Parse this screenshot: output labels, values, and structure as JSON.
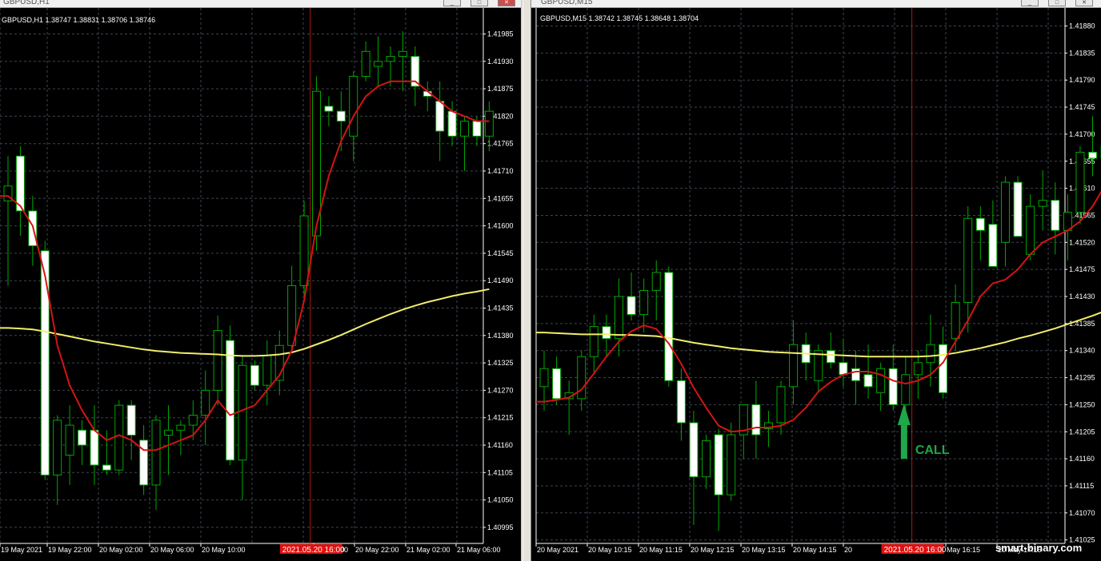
{
  "windows": [
    {
      "title": "GBPUSD,H1",
      "info": "GBPUSD,H1  1.38747 1.38831 1.38706 1.38746",
      "price_labels": [
        "1.41985",
        "1.41930",
        "1.41875",
        "1.41820",
        "1.41765",
        "1.41710",
        "1.41655",
        "1.41600",
        "1.41545",
        "1.41490",
        "1.41435",
        "1.41380",
        "1.41325",
        "1.41270",
        "1.41215",
        "1.41160",
        "1.41105",
        "1.41050",
        "1.40995"
      ],
      "time_labels": [
        "19 May 2021",
        "19 May 22:00",
        "20 May 02:00",
        "20 May 06:00",
        "20 May 10:00",
        "2021.05.20 16:00",
        "May 18:00",
        "20 May 22:00",
        "21 May 02:00",
        "21 May 06:00"
      ],
      "marker_label": "2021.05.20 16:00"
    },
    {
      "title": "GBPUSD,M15",
      "info": "GBPUSD,M15  1.38742 1.38745 1.38648 1.38704",
      "price_labels": [
        "1.41880",
        "1.41835",
        "1.41790",
        "1.41745",
        "1.41700",
        "1.41655",
        "1.41610",
        "1.41565",
        "1.41520",
        "1.41475",
        "1.41430",
        "1.41385",
        "1.41340",
        "1.41295",
        "1.41250",
        "1.41205",
        "1.41160",
        "1.41115",
        "1.41070",
        "1.41025"
      ],
      "time_labels": [
        "20 May 2021",
        "20 May 10:15",
        "20 May 11:15",
        "20 May 12:15",
        "20 May 13:15",
        "20 May 14:15",
        "20",
        "2021.05.20 16:00",
        "May 16:15",
        "20 May 17:15"
      ],
      "marker_label": "2021.05.20 16:00",
      "signal_label": "CALL",
      "watermark": "smart-binary.com"
    }
  ],
  "colors": {
    "background": "#000000",
    "grid": "#3c4452",
    "bull_candle": "#00a800",
    "bear_body": "#ffffff",
    "ma_fast": "#d41414",
    "ma_slow": "#f2ee6a",
    "marker": "#b01818",
    "marker_label_bg": "#e01010",
    "signal_arrow": "#1ea84a"
  },
  "chart_data": [
    {
      "type": "candlestick",
      "symbol": "GBPUSD",
      "timeframe": "H1",
      "ylim": [
        1.40975,
        1.42005
      ],
      "candles": [
        {
          "o": 1.4165,
          "h": 1.4174,
          "l": 1.4148,
          "c": 1.4168
        },
        {
          "o": 1.4174,
          "h": 1.4176,
          "l": 1.4158,
          "c": 1.4163
        },
        {
          "o": 1.4163,
          "h": 1.4166,
          "l": 1.4152,
          "c": 1.4156
        },
        {
          "o": 1.4155,
          "h": 1.4157,
          "l": 1.4109,
          "c": 1.411
        },
        {
          "o": 1.411,
          "h": 1.4122,
          "l": 1.4104,
          "c": 1.4121
        },
        {
          "o": 1.4114,
          "h": 1.4124,
          "l": 1.4108,
          "c": 1.412
        },
        {
          "o": 1.4119,
          "h": 1.4121,
          "l": 1.4112,
          "c": 1.4116
        },
        {
          "o": 1.4119,
          "h": 1.4124,
          "l": 1.4108,
          "c": 1.4112
        },
        {
          "o": 1.4112,
          "h": 1.4119,
          "l": 1.411,
          "c": 1.4111
        },
        {
          "o": 1.4111,
          "h": 1.4125,
          "l": 1.411,
          "c": 1.4124
        },
        {
          "o": 1.4124,
          "h": 1.4125,
          "l": 1.4113,
          "c": 1.4118
        },
        {
          "o": 1.4117,
          "h": 1.412,
          "l": 1.4106,
          "c": 1.4108
        },
        {
          "o": 1.4108,
          "h": 1.4122,
          "l": 1.4103,
          "c": 1.4121
        },
        {
          "o": 1.4118,
          "h": 1.4124,
          "l": 1.411,
          "c": 1.4119
        },
        {
          "o": 1.4119,
          "h": 1.4121,
          "l": 1.4114,
          "c": 1.412
        },
        {
          "o": 1.412,
          "h": 1.4125,
          "l": 1.4117,
          "c": 1.4122
        },
        {
          "o": 1.4122,
          "h": 1.4131,
          "l": 1.4116,
          "c": 1.4127
        },
        {
          "o": 1.4127,
          "h": 1.4142,
          "l": 1.4124,
          "c": 1.4139
        },
        {
          "o": 1.4137,
          "h": 1.414,
          "l": 1.4112,
          "c": 1.4113
        },
        {
          "o": 1.4113,
          "h": 1.4134,
          "l": 1.4105,
          "c": 1.4132
        },
        {
          "o": 1.4132,
          "h": 1.4133,
          "l": 1.4127,
          "c": 1.4128
        },
        {
          "o": 1.4128,
          "h": 1.4137,
          "l": 1.4124,
          "c": 1.4134
        },
        {
          "o": 1.4129,
          "h": 1.4139,
          "l": 1.4126,
          "c": 1.4136
        },
        {
          "o": 1.4136,
          "h": 1.4152,
          "l": 1.4135,
          "c": 1.4148
        },
        {
          "o": 1.4148,
          "h": 1.4165,
          "l": 1.4146,
          "c": 1.4162
        },
        {
          "o": 1.4158,
          "h": 1.419,
          "l": 1.4155,
          "c": 1.4187
        },
        {
          "o": 1.4184,
          "h": 1.4186,
          "l": 1.418,
          "c": 1.4183
        },
        {
          "o": 1.4183,
          "h": 1.4187,
          "l": 1.4175,
          "c": 1.4181
        },
        {
          "o": 1.4178,
          "h": 1.4191,
          "l": 1.4173,
          "c": 1.419
        },
        {
          "o": 1.419,
          "h": 1.4197,
          "l": 1.4189,
          "c": 1.4195
        },
        {
          "o": 1.4192,
          "h": 1.4198,
          "l": 1.4188,
          "c": 1.4193
        },
        {
          "o": 1.4193,
          "h": 1.4196,
          "l": 1.4188,
          "c": 1.4194
        },
        {
          "o": 1.4194,
          "h": 1.4199,
          "l": 1.4187,
          "c": 1.4195
        },
        {
          "o": 1.4194,
          "h": 1.4196,
          "l": 1.4184,
          "c": 1.4188
        },
        {
          "o": 1.4187,
          "h": 1.4189,
          "l": 1.4183,
          "c": 1.4186
        },
        {
          "o": 1.4185,
          "h": 1.4189,
          "l": 1.4173,
          "c": 1.4179
        },
        {
          "o": 1.4183,
          "h": 1.4185,
          "l": 1.4176,
          "c": 1.4178
        },
        {
          "o": 1.4178,
          "h": 1.4182,
          "l": 1.4171,
          "c": 1.4181
        },
        {
          "o": 1.4181,
          "h": 1.4182,
          "l": 1.4176,
          "c": 1.4178
        },
        {
          "o": 1.4178,
          "h": 1.4185,
          "l": 1.4175,
          "c": 1.4183
        }
      ],
      "ma_fast": [
        1.4166,
        1.4164,
        1.416,
        1.415,
        1.4136,
        1.4128,
        1.4123,
        1.4119,
        1.4117,
        1.4118,
        1.4117,
        1.4115,
        1.4115,
        1.4116,
        1.4117,
        1.4118,
        1.4121,
        1.4125,
        1.4122,
        1.4123,
        1.4124,
        1.4127,
        1.413,
        1.4135,
        1.4145,
        1.416,
        1.417,
        1.4177,
        1.4182,
        1.4186,
        1.4188,
        1.4189,
        1.4189,
        1.4189,
        1.4187,
        1.4185,
        1.4183,
        1.4182,
        1.4181,
        1.4181
      ],
      "ma_slow": [
        1.41395,
        1.41394,
        1.41392,
        1.41388,
        1.41383,
        1.41378,
        1.41373,
        1.41368,
        1.41364,
        1.4136,
        1.41356,
        1.41352,
        1.41349,
        1.41347,
        1.41345,
        1.41344,
        1.41343,
        1.41342,
        1.4134,
        1.41339,
        1.41339,
        1.4134,
        1.41342,
        1.41346,
        1.41353,
        1.41362,
        1.41371,
        1.41381,
        1.41392,
        1.41403,
        1.41413,
        1.41423,
        1.41432,
        1.4144,
        1.41447,
        1.41453,
        1.41459,
        1.41464,
        1.41468,
        1.41473
      ],
      "marker_index": 24.5
    },
    {
      "type": "candlestick",
      "symbol": "GBPUSD",
      "timeframe": "M15",
      "ylim": [
        1.41015,
        1.41895
      ],
      "candles": [
        {
          "o": 1.4128,
          "h": 1.4134,
          "l": 1.4124,
          "c": 1.4131
        },
        {
          "o": 1.4131,
          "h": 1.4133,
          "l": 1.4125,
          "c": 1.4126
        },
        {
          "o": 1.4126,
          "h": 1.4129,
          "l": 1.412,
          "c": 1.4127
        },
        {
          "o": 1.4126,
          "h": 1.4134,
          "l": 1.4124,
          "c": 1.4133
        },
        {
          "o": 1.4133,
          "h": 1.414,
          "l": 1.413,
          "c": 1.4138
        },
        {
          "o": 1.4138,
          "h": 1.414,
          "l": 1.4133,
          "c": 1.4136
        },
        {
          "o": 1.4136,
          "h": 1.4146,
          "l": 1.4133,
          "c": 1.4143
        },
        {
          "o": 1.4143,
          "h": 1.4147,
          "l": 1.4139,
          "c": 1.414
        },
        {
          "o": 1.414,
          "h": 1.4146,
          "l": 1.4137,
          "c": 1.4144
        },
        {
          "o": 1.4144,
          "h": 1.4149,
          "l": 1.4139,
          "c": 1.4147
        },
        {
          "o": 1.4147,
          "h": 1.4148,
          "l": 1.4128,
          "c": 1.4129
        },
        {
          "o": 1.4129,
          "h": 1.4131,
          "l": 1.4119,
          "c": 1.4122
        },
        {
          "o": 1.4122,
          "h": 1.4124,
          "l": 1.4105,
          "c": 1.4113
        },
        {
          "o": 1.4113,
          "h": 1.412,
          "l": 1.4111,
          "c": 1.4119
        },
        {
          "o": 1.412,
          "h": 1.4121,
          "l": 1.4104,
          "c": 1.411
        },
        {
          "o": 1.411,
          "h": 1.4122,
          "l": 1.4109,
          "c": 1.412
        },
        {
          "o": 1.412,
          "h": 1.4125,
          "l": 1.4116,
          "c": 1.4125
        },
        {
          "o": 1.4125,
          "h": 1.4129,
          "l": 1.4116,
          "c": 1.412
        },
        {
          "o": 1.4121,
          "h": 1.4124,
          "l": 1.4118,
          "c": 1.4122
        },
        {
          "o": 1.4122,
          "h": 1.4129,
          "l": 1.412,
          "c": 1.4128
        },
        {
          "o": 1.4128,
          "h": 1.4139,
          "l": 1.4125,
          "c": 1.4135
        },
        {
          "o": 1.4135,
          "h": 1.4137,
          "l": 1.4129,
          "c": 1.4132
        },
        {
          "o": 1.4129,
          "h": 1.4135,
          "l": 1.4127,
          "c": 1.4134
        },
        {
          "o": 1.4134,
          "h": 1.4137,
          "l": 1.4131,
          "c": 1.4132
        },
        {
          "o": 1.4132,
          "h": 1.4136,
          "l": 1.4128,
          "c": 1.413
        },
        {
          "o": 1.4131,
          "h": 1.4134,
          "l": 1.4125,
          "c": 1.4129
        },
        {
          "o": 1.413,
          "h": 1.4135,
          "l": 1.4126,
          "c": 1.4128
        },
        {
          "o": 1.4127,
          "h": 1.4132,
          "l": 1.4124,
          "c": 1.4131
        },
        {
          "o": 1.4131,
          "h": 1.4135,
          "l": 1.4124,
          "c": 1.4125
        },
        {
          "o": 1.4125,
          "h": 1.4133,
          "l": 1.4122,
          "c": 1.413
        },
        {
          "o": 1.413,
          "h": 1.4134,
          "l": 1.4126,
          "c": 1.4132
        },
        {
          "o": 1.4132,
          "h": 1.414,
          "l": 1.4128,
          "c": 1.4135
        },
        {
          "o": 1.4135,
          "h": 1.4138,
          "l": 1.4126,
          "c": 1.4127
        },
        {
          "o": 1.4136,
          "h": 1.4145,
          "l": 1.4134,
          "c": 1.4142
        },
        {
          "o": 1.4142,
          "h": 1.4158,
          "l": 1.4137,
          "c": 1.4156
        },
        {
          "o": 1.4156,
          "h": 1.4158,
          "l": 1.4149,
          "c": 1.4154
        },
        {
          "o": 1.4155,
          "h": 1.4159,
          "l": 1.4148,
          "c": 1.4148
        },
        {
          "o": 1.4152,
          "h": 1.4163,
          "l": 1.4148,
          "c": 1.4162
        },
        {
          "o": 1.4162,
          "h": 1.4163,
          "l": 1.4153,
          "c": 1.4153
        },
        {
          "o": 1.415,
          "h": 1.416,
          "l": 1.4149,
          "c": 1.4158
        },
        {
          "o": 1.4158,
          "h": 1.4164,
          "l": 1.4154,
          "c": 1.4159
        },
        {
          "o": 1.4159,
          "h": 1.4162,
          "l": 1.415,
          "c": 1.4154
        },
        {
          "o": 1.4154,
          "h": 1.416,
          "l": 1.4149,
          "c": 1.4157
        },
        {
          "o": 1.4157,
          "h": 1.4168,
          "l": 1.4155,
          "c": 1.4167
        },
        {
          "o": 1.4167,
          "h": 1.4173,
          "l": 1.4163,
          "c": 1.4166
        },
        {
          "o": 1.4166,
          "h": 1.417,
          "l": 1.4164,
          "c": 1.4168
        },
        {
          "o": 1.4168,
          "h": 1.4183,
          "l": 1.4163,
          "c": 1.4179
        },
        {
          "o": 1.4179,
          "h": 1.4187,
          "l": 1.4175,
          "c": 1.4184
        },
        {
          "o": 1.4184,
          "h": 1.4186,
          "l": 1.4179,
          "c": 1.418
        },
        {
          "o": 1.418,
          "h": 1.4185,
          "l": 1.4178,
          "c": 1.4184
        },
        {
          "o": 1.4183,
          "h": 1.4185,
          "l": 1.4177,
          "c": 1.418
        },
        {
          "o": 1.418,
          "h": 1.4186,
          "l": 1.4178,
          "c": 1.4183
        }
      ],
      "ma_fast": [
        1.41255,
        1.41258,
        1.41262,
        1.41275,
        1.41302,
        1.4133,
        1.41355,
        1.41372,
        1.41382,
        1.41376,
        1.41352,
        1.41318,
        1.41278,
        1.41245,
        1.41215,
        1.41205,
        1.41207,
        1.41212,
        1.41212,
        1.41215,
        1.41225,
        1.41245,
        1.41272,
        1.41288,
        1.413,
        1.41305,
        1.41305,
        1.413,
        1.4129,
        1.41285,
        1.4129,
        1.413,
        1.4132,
        1.41355,
        1.4139,
        1.4143,
        1.41452,
        1.41458,
        1.41475,
        1.415,
        1.4152,
        1.4153,
        1.4154,
        1.41555,
        1.4158,
        1.41615,
        1.41655,
        1.4171,
        1.41745,
        1.4177,
        1.4178,
        1.4179
      ],
      "ma_slow": [
        1.4137,
        1.41369,
        1.41368,
        1.41367,
        1.41367,
        1.41367,
        1.41366,
        1.41366,
        1.41365,
        1.41364,
        1.41361,
        1.41357,
        1.41353,
        1.4135,
        1.41347,
        1.41344,
        1.41342,
        1.4134,
        1.41338,
        1.41337,
        1.41336,
        1.41335,
        1.41334,
        1.41333,
        1.41332,
        1.41331,
        1.4133,
        1.4133,
        1.4133,
        1.4133,
        1.4133,
        1.41331,
        1.41333,
        1.41336,
        1.4134,
        1.41344,
        1.41349,
        1.41354,
        1.4136,
        1.41365,
        1.41371,
        1.41377,
        1.41384,
        1.41391,
        1.41398,
        1.41406,
        1.41414,
        1.41422,
        1.4143,
        1.41438,
        1.41446,
        1.41454
      ],
      "marker_index": 29.5,
      "signal_index": 29
    }
  ]
}
